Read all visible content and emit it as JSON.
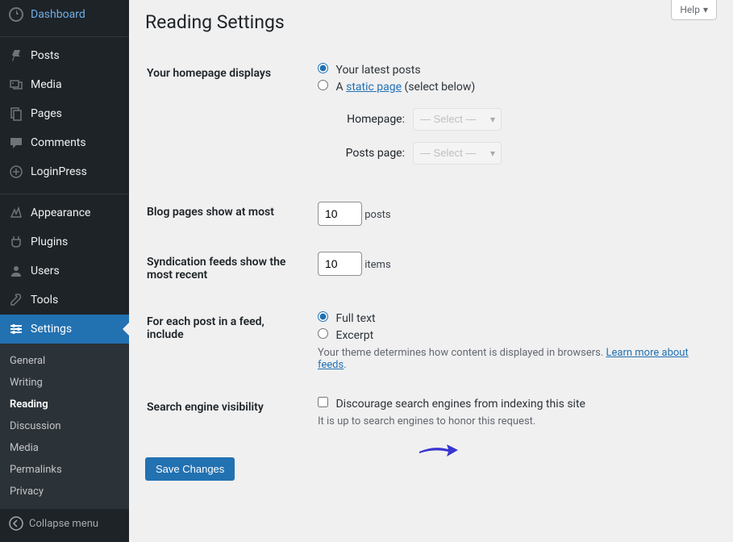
{
  "help_label": "Help",
  "page_title": "Reading Settings",
  "sidebar": {
    "items": [
      {
        "label": "Dashboard"
      },
      {
        "label": "Posts"
      },
      {
        "label": "Media"
      },
      {
        "label": "Pages"
      },
      {
        "label": "Comments"
      },
      {
        "label": "LoginPress"
      },
      {
        "label": "Appearance"
      },
      {
        "label": "Plugins"
      },
      {
        "label": "Users"
      },
      {
        "label": "Tools"
      },
      {
        "label": "Settings"
      }
    ],
    "submenu": [
      {
        "label": "General"
      },
      {
        "label": "Writing"
      },
      {
        "label": "Reading"
      },
      {
        "label": "Discussion"
      },
      {
        "label": "Media"
      },
      {
        "label": "Permalinks"
      },
      {
        "label": "Privacy"
      }
    ],
    "collapse_label": "Collapse menu"
  },
  "form": {
    "homepage": {
      "label": "Your homepage displays",
      "opt_latest": "Your latest posts",
      "opt_static_prefix": "A ",
      "opt_static_link": "static page",
      "opt_static_suffix": " (select below)",
      "homepage_label": "Homepage:",
      "postspage_label": "Posts page:",
      "select_placeholder": "— Select —"
    },
    "blog_pages": {
      "label": "Blog pages show at most",
      "value": "10",
      "suffix": "posts"
    },
    "syndication": {
      "label": "Syndication feeds show the most recent",
      "value": "10",
      "suffix": "items"
    },
    "feed_include": {
      "label": "For each post in a feed, include",
      "opt_full": "Full text",
      "opt_excerpt": "Excerpt",
      "desc_prefix": "Your theme determines how content is displayed in browsers. ",
      "desc_link": "Learn more about feeds",
      "desc_suffix": "."
    },
    "seo": {
      "label": "Search engine visibility",
      "opt": "Discourage search engines from indexing this site",
      "desc": "It is up to search engines to honor this request."
    },
    "save_label": "Save Changes"
  }
}
